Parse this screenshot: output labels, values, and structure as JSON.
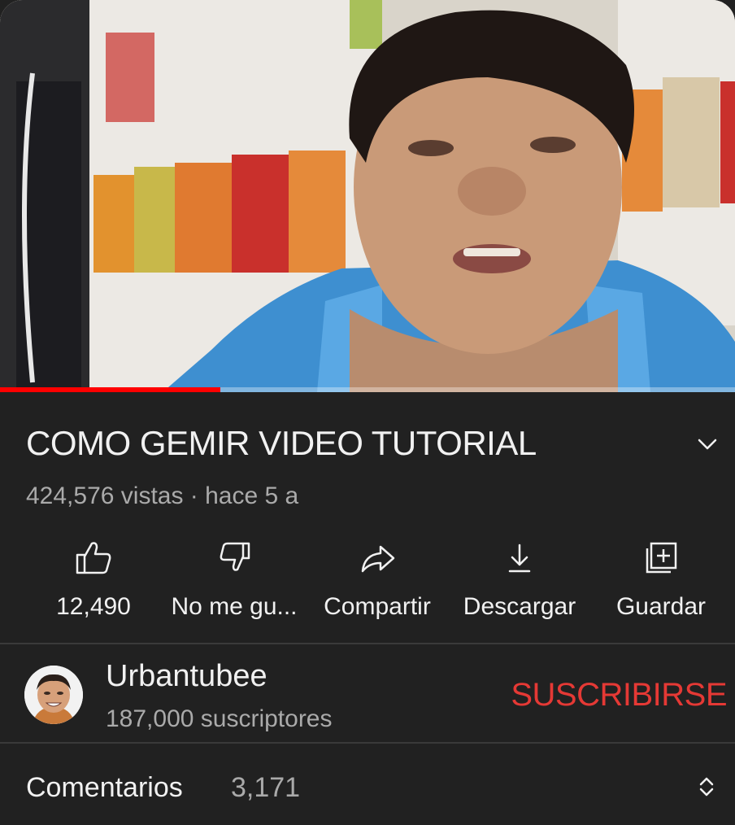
{
  "video": {
    "title": "COMO GEMIR VIDEO TUTORIAL",
    "meta": "424,576 vistas · hace 5 a",
    "progress_fraction": 0.3
  },
  "actions": {
    "like_label": "12,490",
    "dislike_label": "No me gu...",
    "share_label": "Compartir",
    "download_label": "Descargar",
    "save_label": "Guardar"
  },
  "channel": {
    "name": "Urbantubee",
    "subscribers": "187,000 suscriptores",
    "subscribe_label": "SUSCRIBIRSE"
  },
  "comments": {
    "label": "Comentarios",
    "count": "3,171"
  },
  "icons": {
    "expand": "chevron-down-icon",
    "like": "thumbs-up-icon",
    "dislike": "thumbs-down-icon",
    "share": "share-arrow-icon",
    "download": "download-icon",
    "save": "add-to-playlist-icon",
    "comments_toggle": "unfold-icon"
  },
  "colors": {
    "background": "#212121",
    "subscribe": "#e53935",
    "progress": "#ff0000"
  }
}
